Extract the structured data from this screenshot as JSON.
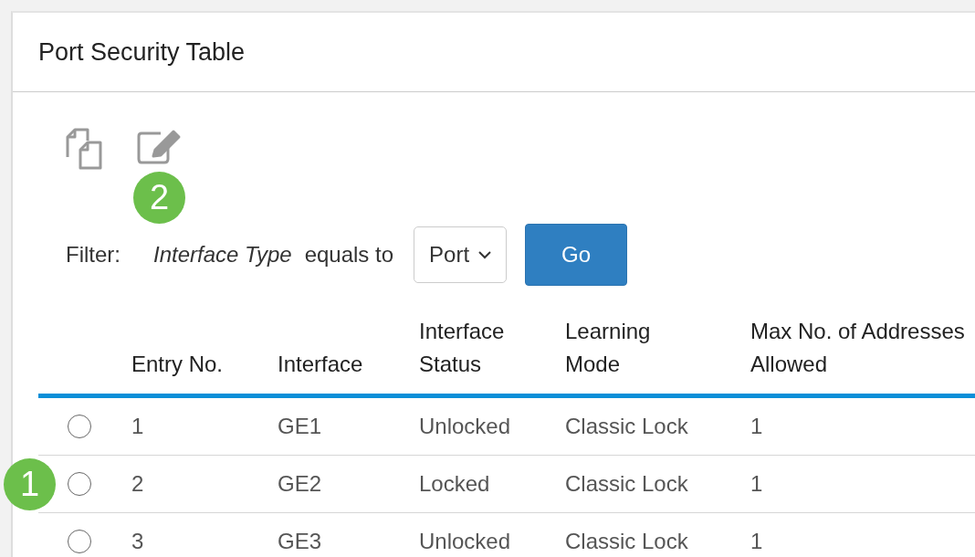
{
  "panel": {
    "title": "Port Security Table"
  },
  "toolbar": [
    {
      "kind": "copy"
    },
    {
      "kind": "edit",
      "callout": "2"
    }
  ],
  "filter": {
    "label": "Filter:",
    "field": "Interface Type",
    "operator": "equals to",
    "select_value": "Port",
    "button": "Go"
  },
  "table": {
    "columns": [
      "Entry No.",
      "Interface",
      "Interface Status",
      "Learning Mode",
      "Max No. of Addresses Allowed"
    ],
    "rows": [
      {
        "selected": false,
        "cells": [
          "1",
          "GE1",
          "Unlocked",
          "Classic Lock",
          "1"
        ]
      },
      {
        "selected": false,
        "callout": "1",
        "cells": [
          "2",
          "GE2",
          "Locked",
          "Classic Lock",
          "1"
        ]
      },
      {
        "selected": false,
        "cells": [
          "3",
          "GE3",
          "Unlocked",
          "Classic Lock",
          "1"
        ]
      }
    ]
  }
}
